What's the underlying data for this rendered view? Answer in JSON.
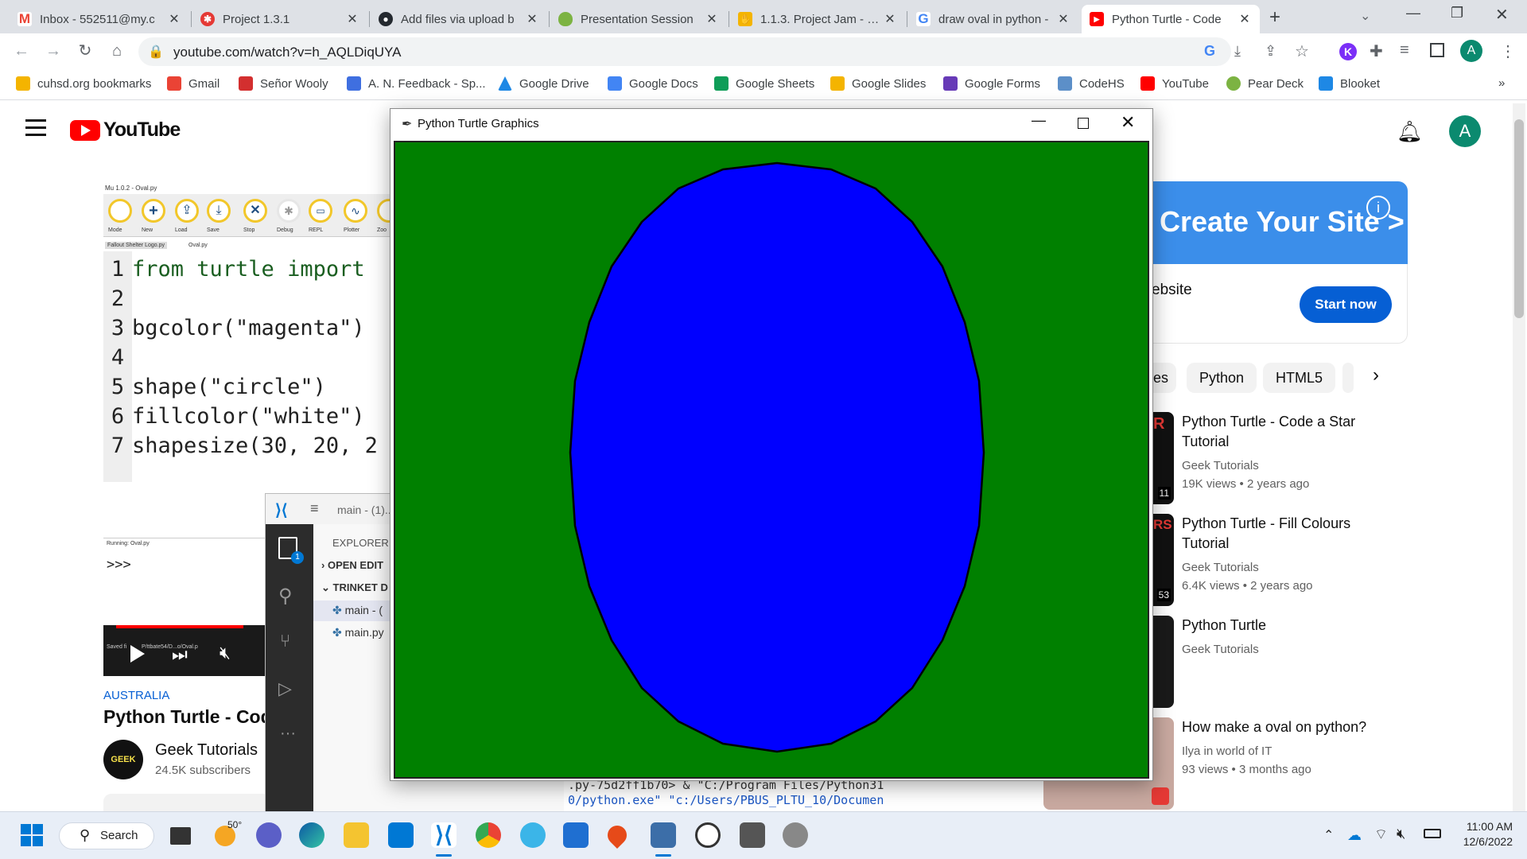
{
  "browser": {
    "tabs": [
      {
        "title": "Inbox - 552511@my.c",
        "icon": "gmail-icon",
        "color": "#ea4335"
      },
      {
        "title": "Project 1.3.1",
        "icon": "gear-wheel-icon",
        "color": "#e53935"
      },
      {
        "title": "Add files via upload b",
        "icon": "github-icon",
        "color": "#24292f"
      },
      {
        "title": "Presentation Session",
        "icon": "pear-icon",
        "color": "#7cb342"
      },
      {
        "title": "1.1.3. Project Jam - Go",
        "icon": "hand-icon",
        "color": "#f4b400"
      },
      {
        "title": "draw oval in python -",
        "icon": "google-icon",
        "color": "#4285f4"
      },
      {
        "title": "Python Turtle - Code",
        "icon": "youtube-icon",
        "color": "#ff0000"
      }
    ],
    "url": "youtube.com/watch?v=h_AQLDiqUYA",
    "bookmarks": [
      {
        "label": "cuhsd.org bookmarks",
        "color": "#f4b400"
      },
      {
        "label": "Gmail",
        "color": "#ea4335"
      },
      {
        "label": "Señor Wooly",
        "color": "#d32f2f"
      },
      {
        "label": "A. N. Feedback - Sp...",
        "color": "#3f6fe0"
      },
      {
        "label": "Google Drive",
        "color": "#1e88e5"
      },
      {
        "label": "Google Docs",
        "color": "#4285f4"
      },
      {
        "label": "Google Sheets",
        "color": "#0f9d58"
      },
      {
        "label": "Google Slides",
        "color": "#f4b400"
      },
      {
        "label": "Google Forms",
        "color": "#673ab7"
      },
      {
        "label": "CodeHS",
        "color": "#5c8fc8"
      },
      {
        "label": "YouTube",
        "color": "#ff0000"
      },
      {
        "label": "Pear Deck",
        "color": "#7cb342"
      },
      {
        "label": "Blooket",
        "color": "#1e88e5"
      }
    ],
    "more_label": "»",
    "avatar_letter": "A"
  },
  "youtube": {
    "logo_text": "YouTube",
    "avatar_letter": "A",
    "video": {
      "mu_title": "Mu 1.0.2 - Oval.py",
      "mu_buttons": [
        "Mode",
        "New",
        "Load",
        "Save",
        "Stop",
        "Debug",
        "REPL",
        "Plotter",
        "Zoo"
      ],
      "mu_tabs": [
        "Fallout Shelter Logo.py",
        "Oval.py"
      ],
      "code_lines": [
        {
          "n": "1",
          "text": "from turtle import"
        },
        {
          "n": "2",
          "text": ""
        },
        {
          "n": "3",
          "text": "bgcolor(\"magenta\")"
        },
        {
          "n": "4",
          "text": ""
        },
        {
          "n": "5",
          "text": "shape(\"circle\")"
        },
        {
          "n": "6",
          "text": "fillcolor(\"white\")"
        },
        {
          "n": "7",
          "text": "shapesize(30, 20, 2"
        }
      ],
      "running_label": "Running: Oval.py",
      "prompt": ">>>",
      "saved_label": "Saved fi",
      "saved_path": "P/ttbate54/D...o/Oval.p"
    },
    "country": "AUSTRALIA",
    "title": "Python Turtle - Cod",
    "channel": "Geek Tutorials",
    "subscribers": "24.5K subscribers",
    "ad": {
      "headline": "Create Your Site >",
      "line": "ebsite",
      "cta": "Start now"
    },
    "chips": [
      "es",
      "Python",
      "HTML5"
    ],
    "related": [
      {
        "title": "Python Turtle - Code a Star Tutorial",
        "channel": "Geek Tutorials",
        "views": "19K views",
        "age": "2 years ago",
        "badge": "11"
      },
      {
        "title": "Python Turtle - Fill Colours Tutorial",
        "channel": "Geek Tutorials",
        "views": "6.4K views",
        "age": "2 years ago",
        "badge": "53"
      },
      {
        "title": "Python Turtle",
        "channel": "Geek Tutorials",
        "views": "",
        "age": "",
        "badge": ""
      },
      {
        "title": "How make a oval on python?",
        "channel": "Ilya in world of IT",
        "views": "93 views",
        "age": "3 months ago",
        "badge": ""
      }
    ]
  },
  "vscode": {
    "title": "main - (1)...",
    "explorer": "EXPLORER",
    "open_editors": "OPEN EDIT",
    "trinket": "TRINKET D",
    "files": [
      "main - (",
      "main.py"
    ],
    "badge": "1",
    "terminal_lines": [
      ".py-75d2ff1b70> & \"C:/Program Files/Python31",
      "0/python.exe\" \"c:/Users/PBUS_PLTU_10/Documen"
    ]
  },
  "turtle_window": {
    "title": "Python Turtle Graphics",
    "canvas_color": "#008000",
    "oval_fill": "#0000ff",
    "oval_stroke": "#000000"
  },
  "taskbar": {
    "search_label": "Search",
    "weather": "50°",
    "time": "11:00 AM",
    "date": "12/6/2022"
  }
}
